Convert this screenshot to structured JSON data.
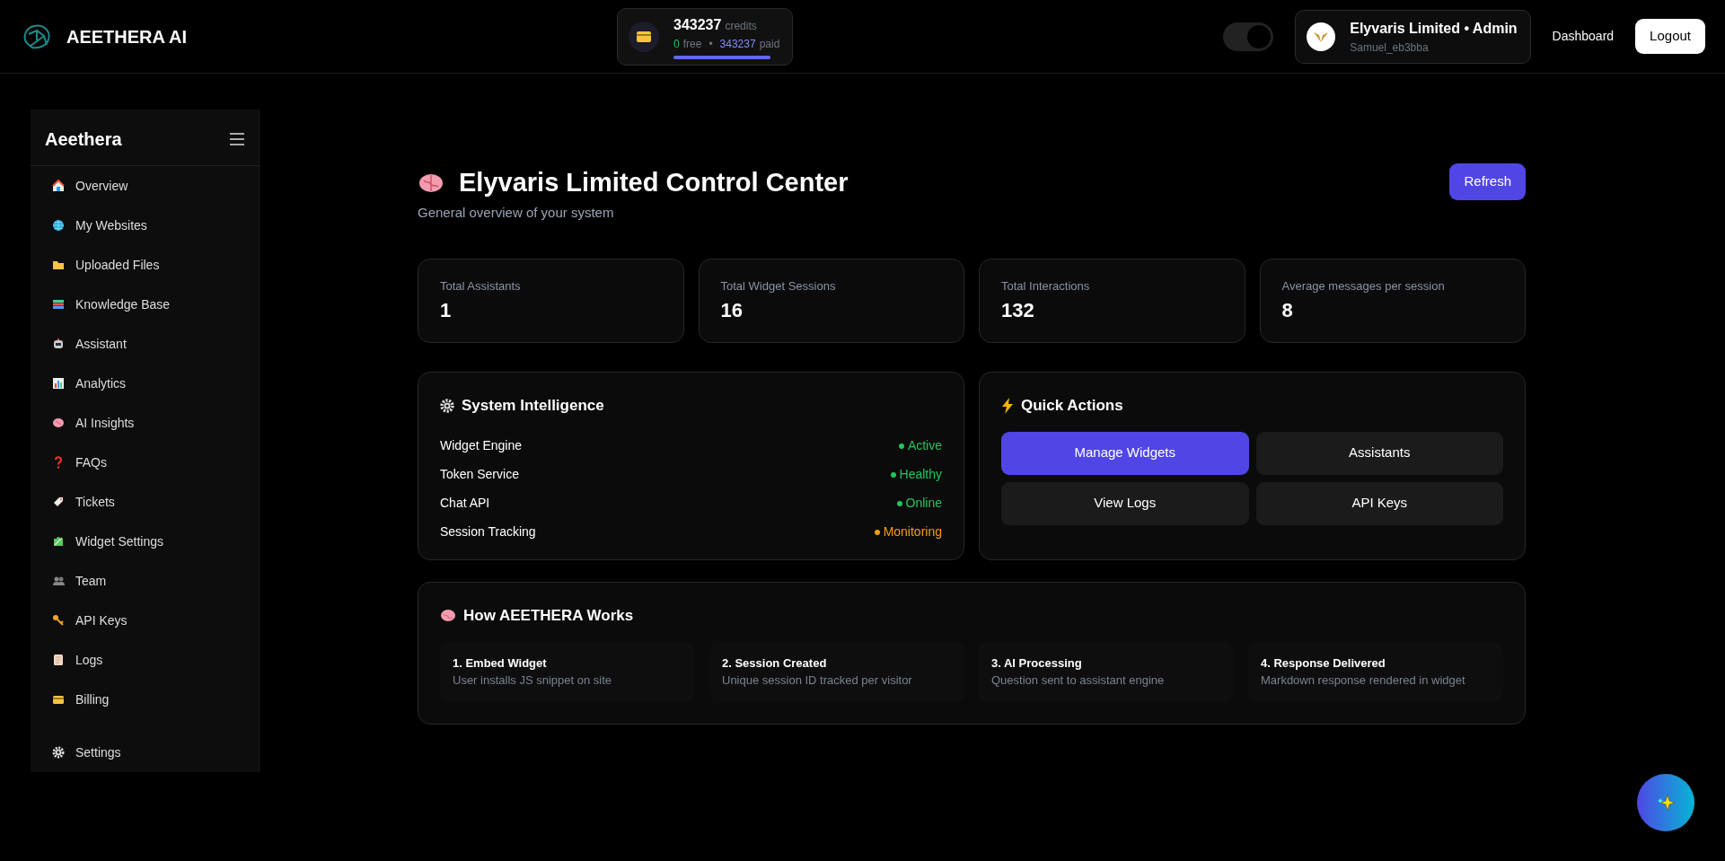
{
  "header": {
    "brand": "AEETHERA AI",
    "credits": {
      "amount": "343237",
      "unit": "credits",
      "free": "0",
      "free_label": "free",
      "separator": "•",
      "paid": "343237",
      "paid_label": "paid",
      "level": 1
    },
    "theme_toggle": {
      "on": true
    },
    "account": {
      "title": "Elyvaris Limited • Admin",
      "user": "Samuel_eb3bba"
    },
    "links": [
      "Dashboard"
    ],
    "logout": "Logout"
  },
  "sidebar": {
    "title": "Aeethera",
    "items": [
      {
        "label": "Overview"
      },
      {
        "label": "My Websites"
      },
      {
        "label": "Uploaded Files"
      },
      {
        "label": "Knowledge Base"
      },
      {
        "label": "Assistant"
      },
      {
        "label": "Analytics"
      },
      {
        "label": "AI Insights"
      },
      {
        "label": "FAQs"
      },
      {
        "label": "Tickets"
      },
      {
        "label": "Widget Settings"
      },
      {
        "label": "Team"
      },
      {
        "label": "API Keys"
      },
      {
        "label": "Logs"
      },
      {
        "label": "Billing"
      }
    ],
    "footer_item": {
      "label": "Settings"
    }
  },
  "page": {
    "title": "Elyvaris Limited Control Center",
    "subtitle": "General overview of your system",
    "refresh": "Refresh"
  },
  "stats": [
    {
      "label": "Total Assistants",
      "value": "1"
    },
    {
      "label": "Total Widget Sessions",
      "value": "16"
    },
    {
      "label": "Total Interactions",
      "value": "132"
    },
    {
      "label": "Average messages per session",
      "value": "8"
    }
  ],
  "system": {
    "title": "System Intelligence",
    "rows": [
      {
        "name": "Widget Engine",
        "status": "Active",
        "color": "#22c55e"
      },
      {
        "name": "Token Service",
        "status": "Healthy",
        "color": "#22c55e"
      },
      {
        "name": "Chat API",
        "status": "Online",
        "color": "#22c55e"
      },
      {
        "name": "Session Tracking",
        "status": "Monitoring",
        "color": "#f59e0b"
      }
    ]
  },
  "quick_actions": {
    "title": "Quick Actions",
    "buttons": [
      {
        "label": "Manage Widgets",
        "primary": true
      },
      {
        "label": "Assistants",
        "primary": false
      },
      {
        "label": "View Logs",
        "primary": false
      },
      {
        "label": "API Keys",
        "primary": false
      }
    ]
  },
  "how_it_works": {
    "title": "How AEETHERA Works",
    "steps": [
      {
        "title": "1. Embed Widget",
        "text": "User installs JS snippet on site"
      },
      {
        "title": "2. Session Created",
        "text": "Unique session ID tracked per visitor"
      },
      {
        "title": "3. AI Processing",
        "text": "Question sent to assistant engine"
      },
      {
        "title": "4. Response Delivered",
        "text": "Markdown response rendered in widget"
      }
    ]
  }
}
